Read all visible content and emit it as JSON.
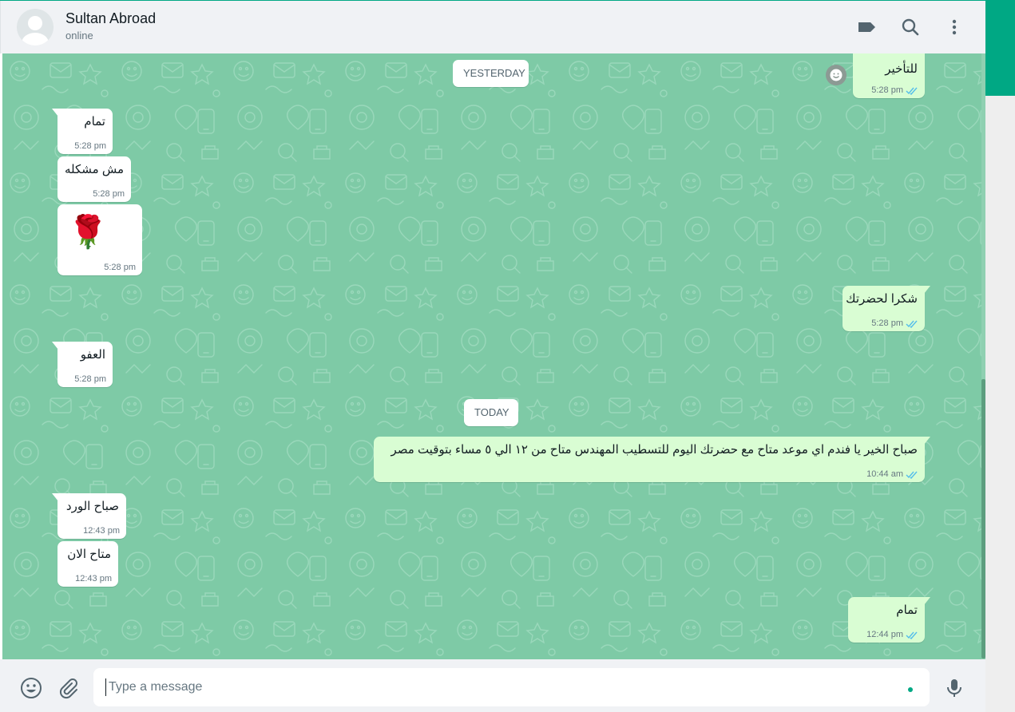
{
  "header": {
    "contact_name": "Sultan Abroad",
    "contact_status": "online",
    "icons": [
      "label-icon",
      "search-icon",
      "menu-icon"
    ]
  },
  "chat": {
    "date_yesterday": "YESTERDAY",
    "date_today": "TODAY",
    "messages": [
      {
        "direction": "out",
        "text": "للتأخير",
        "time": "5:28 pm",
        "status": "read"
      },
      {
        "direction": "in",
        "text": "تمام",
        "time": "5:28 pm"
      },
      {
        "direction": "in",
        "text": "مش مشكله",
        "time": "5:28 pm"
      },
      {
        "direction": "in",
        "text": "🌹",
        "time": "5:28 pm"
      },
      {
        "direction": "out",
        "text": "شكرا لحضرتك",
        "time": "5:28 pm",
        "status": "read"
      },
      {
        "direction": "in",
        "text": "العفو",
        "time": "5:28 pm"
      },
      {
        "direction": "out",
        "text": "صباح الخير يا فندم اي موعد متاح مع حضرتك اليوم للتسطيب المهندس متاح من ١٢ الي ٥ مساء بتوقيت مصر",
        "time": "10:44 am",
        "status": "read"
      },
      {
        "direction": "in",
        "text": "صباح الورد",
        "time": "12:43 pm"
      },
      {
        "direction": "in",
        "text": "متاح الان",
        "time": "12:43 pm"
      },
      {
        "direction": "out",
        "text": "تمام",
        "time": "12:44 pm",
        "status": "read"
      }
    ]
  },
  "composer": {
    "placeholder": "Type a message",
    "value": ""
  },
  "colors": {
    "accent": "#00a884",
    "chat_background": "#7ecaa6",
    "outgoing_bubble": "#d9fdd3",
    "incoming_bubble": "#ffffff",
    "read_ticks": "#53bdeb"
  }
}
